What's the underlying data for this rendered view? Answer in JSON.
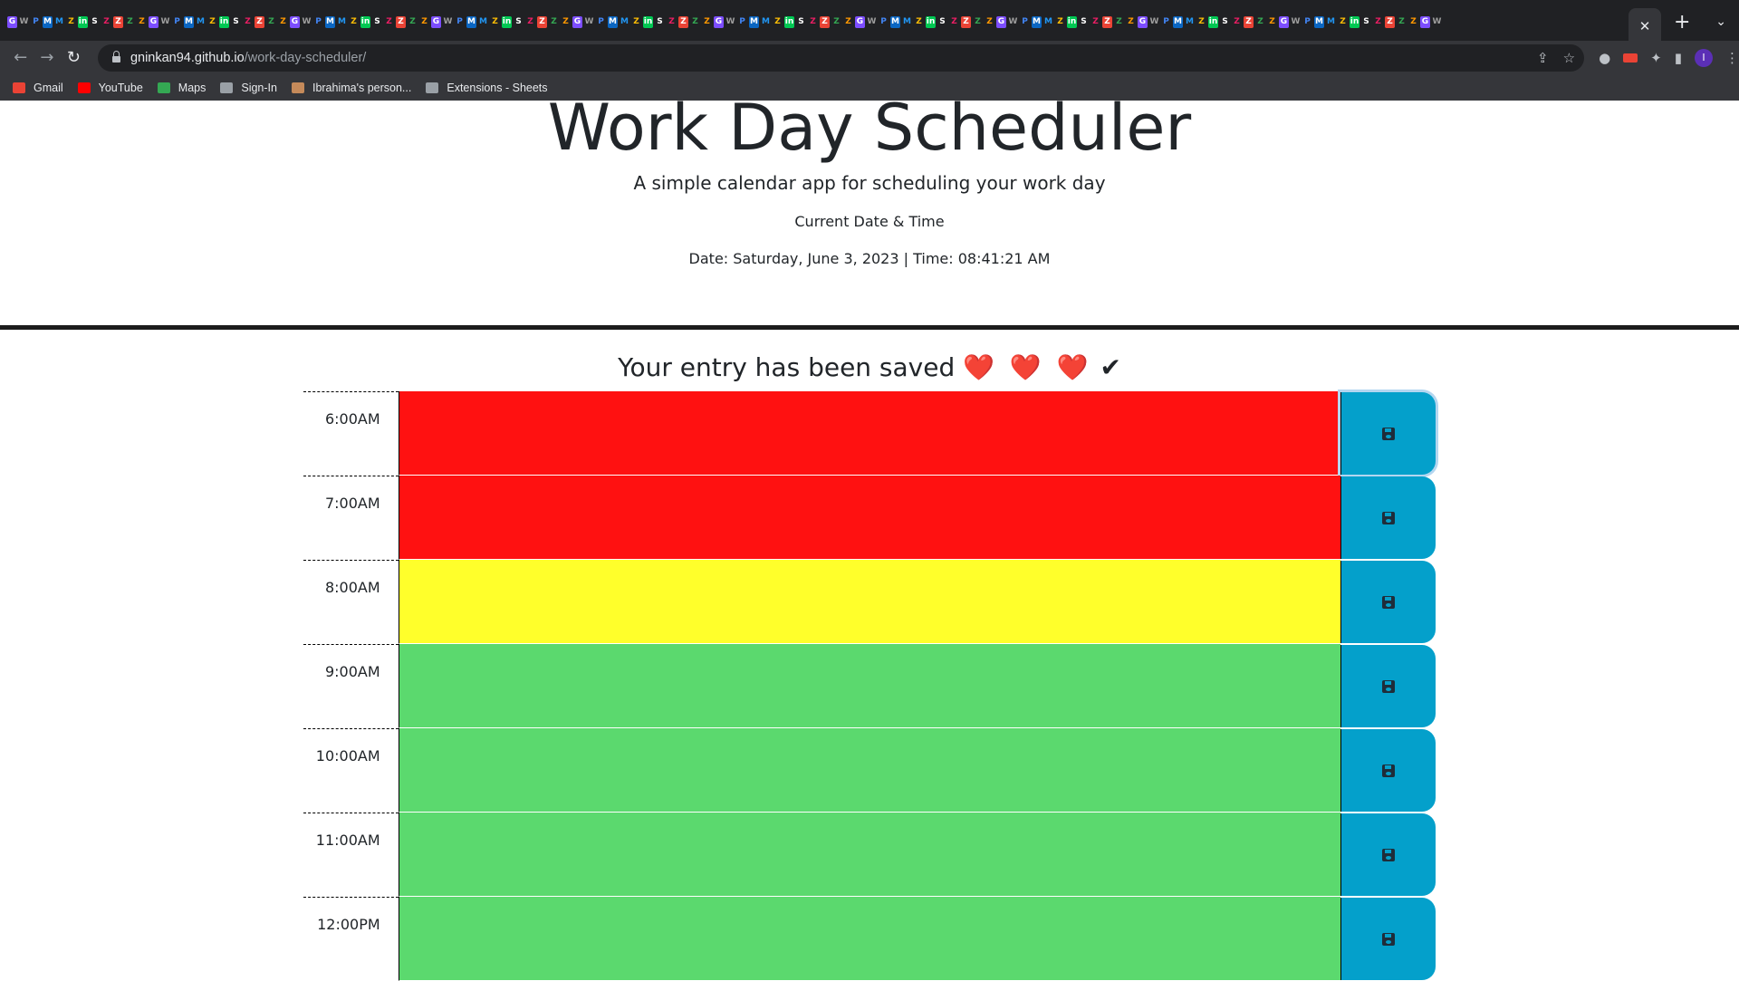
{
  "browser": {
    "url_host": "gninkan94.github.io",
    "url_path": "/work-day-scheduler/",
    "new_tab_symbol": "+",
    "close_tab_symbol": "✕",
    "profile_initial": "I",
    "bookmarks": [
      {
        "label": "Gmail",
        "icon": "gmail-icon",
        "color": "#ea4335"
      },
      {
        "label": "YouTube",
        "icon": "youtube-icon",
        "color": "#ff0000"
      },
      {
        "label": "Maps",
        "icon": "maps-icon",
        "color": "#34a853"
      },
      {
        "label": "Sign-In",
        "icon": "sign-in-icon",
        "color": "#9aa0a6"
      },
      {
        "label": "Ibrahima's person...",
        "icon": "person-icon",
        "color": "#c58a5a"
      },
      {
        "label": "Extensions - Sheets",
        "icon": "puzzle-icon",
        "color": "#9aa0a6"
      }
    ]
  },
  "header": {
    "title": "Work Day Scheduler",
    "subtitle": "A simple calendar app for scheduling your work day",
    "date_label": "Current Date & Time",
    "date_time": "Date: Saturday, June 3, 2023 | Time: 08:41:21 AM"
  },
  "message": {
    "text": "Your entry has been saved",
    "hearts": "❤️ ❤️ ❤️",
    "check": "✔"
  },
  "colors": {
    "past": "#ff1111",
    "present": "#ffff2b",
    "future": "#5bd96e",
    "save_button": "#04a0cb"
  },
  "hours": [
    {
      "label": "6:00AM",
      "status": "past",
      "value": ""
    },
    {
      "label": "7:00AM",
      "status": "past",
      "value": ""
    },
    {
      "label": "8:00AM",
      "status": "present",
      "value": ""
    },
    {
      "label": "9:00AM",
      "status": "future",
      "value": ""
    },
    {
      "label": "10:00AM",
      "status": "future",
      "value": ""
    },
    {
      "label": "11:00AM",
      "status": "future",
      "value": ""
    },
    {
      "label": "12:00PM",
      "status": "future",
      "value": ""
    }
  ]
}
